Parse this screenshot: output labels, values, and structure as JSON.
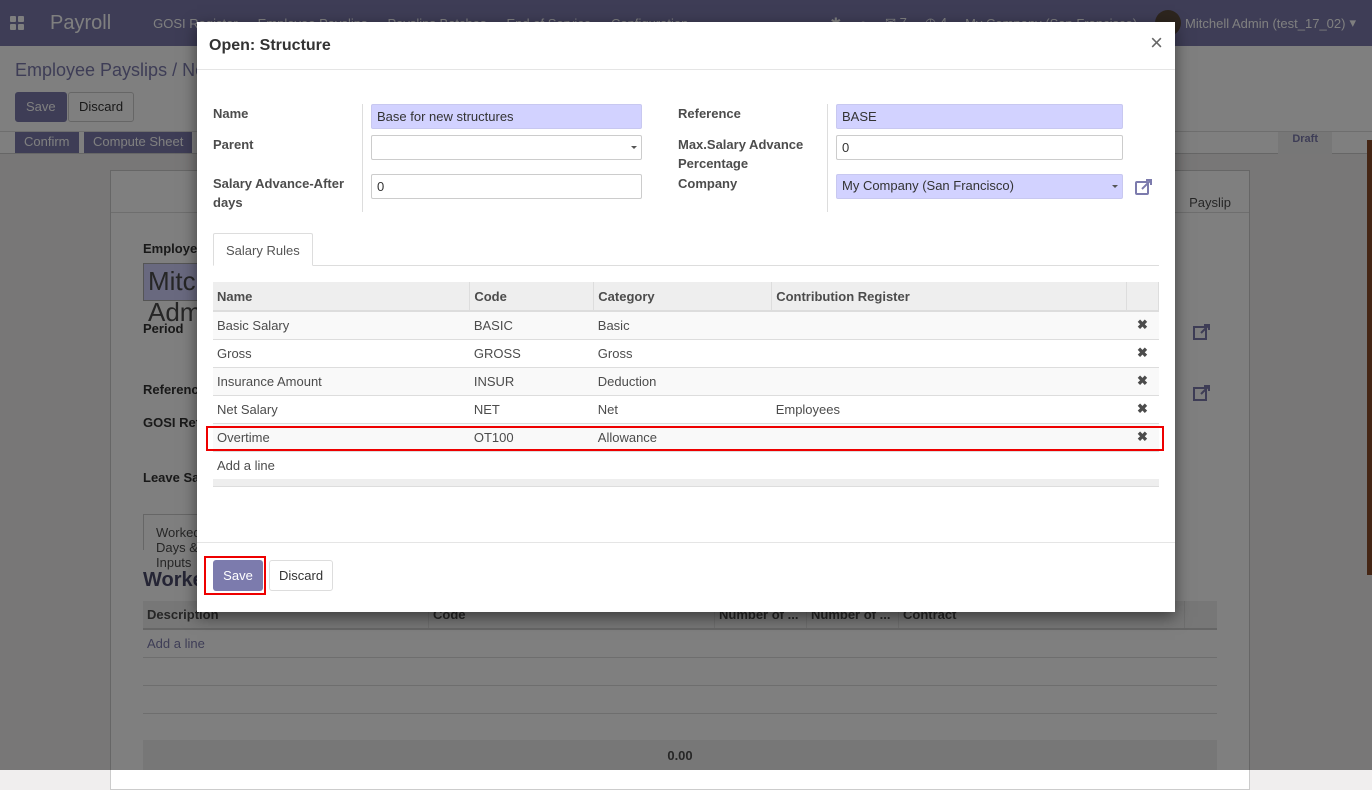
{
  "navbar": {
    "app_name": "Payroll",
    "menu": [
      "GOSI Register",
      "Employee Payslips",
      "Payslips Batches",
      "End of Service",
      "Configuration"
    ],
    "company": "My Company (San Francisco)",
    "messages_count": "7",
    "activity_count": "4",
    "user": "Mitchell Admin (test_17_02)"
  },
  "control_panel": {
    "breadcrumb": "Employee Payslips / New",
    "save_label": "Save",
    "discard_label": "Discard"
  },
  "statusbar": {
    "confirm_label": "Confirm",
    "compute_label": "Compute Sheet",
    "state": "Draft"
  },
  "background_form": {
    "header_link": "Payslip",
    "employee_label": "Employee",
    "employee_value": "Mitchell Admin",
    "period_label": "Period",
    "reference_label": "Reference",
    "gosi_label": "GOSI Reference",
    "leave_label": "Leave Salary",
    "tab_label": "Worked Days & Inputs",
    "section_title": "Worked Days",
    "table_headers": [
      "Description",
      "Code",
      "Number of ...",
      "Number of ...",
      "Contract"
    ],
    "add_line": "Add a line",
    "total": "0.00"
  },
  "modal": {
    "title": "Open: Structure",
    "close_label": "×",
    "fields": {
      "name": {
        "label": "Name",
        "value": "Base for new structures"
      },
      "parent": {
        "label": "Parent",
        "value": ""
      },
      "salary_advance_days": {
        "label": "Salary Advance-After days",
        "value": "0"
      },
      "reference": {
        "label": "Reference",
        "value": "BASE"
      },
      "max_salary_advance": {
        "label": "Max.Salary Advance Percentage",
        "value": "0"
      },
      "company": {
        "label": "Company",
        "value": "My Company (San Francisco)"
      }
    },
    "tab_label": "Salary Rules",
    "table": {
      "headers": [
        "Name",
        "Code",
        "Category",
        "Contribution Register"
      ],
      "rows": [
        {
          "name": "Basic Salary",
          "code": "BASIC",
          "category": "Basic",
          "register": ""
        },
        {
          "name": "Gross",
          "code": "GROSS",
          "category": "Gross",
          "register": ""
        },
        {
          "name": "Insurance Amount",
          "code": "INSUR",
          "category": "Deduction",
          "register": ""
        },
        {
          "name": "Net Salary",
          "code": "NET",
          "category": "Net",
          "register": "Employees"
        },
        {
          "name": "Overtime",
          "code": "OT100",
          "category": "Allowance",
          "register": ""
        }
      ],
      "add_line": "Add a line"
    },
    "save_label": "Save",
    "discard_label": "Discard"
  },
  "colors": {
    "brand": "#7c7bad",
    "required_field": "#d2d2ff",
    "highlight": "#ee0000"
  }
}
